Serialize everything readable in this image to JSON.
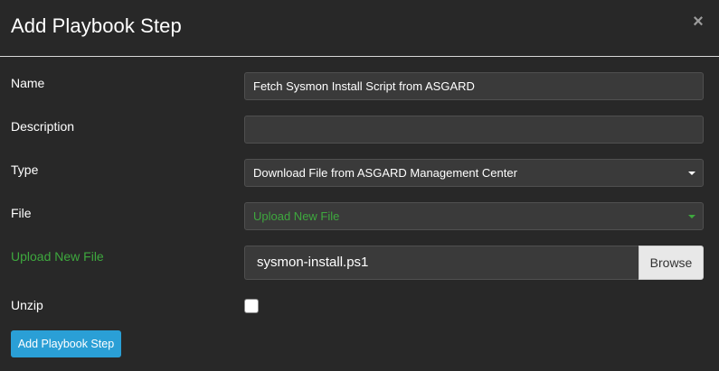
{
  "dialog": {
    "title": "Add Playbook Step",
    "close_icon": "×"
  },
  "form": {
    "name": {
      "label": "Name",
      "value": "Fetch Sysmon Install Script from ASGARD"
    },
    "description": {
      "label": "Description",
      "value": ""
    },
    "type": {
      "label": "Type",
      "value": "Download File from ASGARD Management Center"
    },
    "file": {
      "label": "File",
      "value": "Upload New File"
    },
    "upload": {
      "label": "Upload New File",
      "filename": "sysmon-install.ps1",
      "browse_label": "Browse"
    },
    "unzip": {
      "label": "Unzip",
      "checked": false
    },
    "submit_label": "Add Playbook Step"
  },
  "colors": {
    "background": "#282828",
    "accent_green": "#3ea83e",
    "primary_button": "#2a9fd6"
  }
}
